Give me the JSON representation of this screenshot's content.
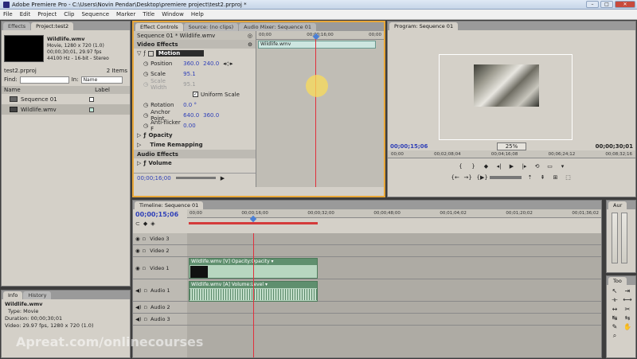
{
  "window": {
    "title": "Adobe Premiere Pro - C:\\Users\\Novin Pendar\\Desktop\\premiere project\\test2.prproj *"
  },
  "menu": [
    "File",
    "Edit",
    "Project",
    "Clip",
    "Sequence",
    "Marker",
    "Title",
    "Window",
    "Help"
  ],
  "project_panel": {
    "tabs": [
      "Effects",
      "Project:test2"
    ],
    "clip_name": "Wildlife.wmv",
    "clip_info_1": "Movie, 1280 x 720 (1.0)",
    "clip_info_2": "00;00;30;01, 29.97 fps",
    "clip_info_3": "44100 Hz - 16-bit - Stereo",
    "project_file": "test2.prproj",
    "items_count": "2 Items",
    "find_label": "Find:",
    "in_label": "In:",
    "in_value": "Name",
    "col_name": "Name",
    "col_label": "Label",
    "items": [
      "Sequence 01",
      "Wildlife.wmv"
    ]
  },
  "info_panel": {
    "tabs": [
      "Info",
      "History"
    ],
    "name": "Wildlife.wmv",
    "type": "Type: Movie",
    "duration": "Duration: 00;00;30;01",
    "video": "Video: 29.97 fps, 1280 x 720 (1.0)"
  },
  "effect_controls": {
    "tabs": [
      "Effect Controls",
      "Source: (no clips)",
      "Audio Mixer: Sequence 01"
    ],
    "header": "Sequence 01 * Wildlife.wmv",
    "timecode_left": "00;00",
    "timecode_mid": "00;00;16;00",
    "timecode_right": "00;00",
    "clip_label": "Wildlife.wmv",
    "section_video": "Video Effects",
    "motion": "Motion",
    "position_label": "Position",
    "position_x": "360.0",
    "position_y": "240.0",
    "scale_label": "Scale",
    "scale_value": "95.1",
    "scale_width_label": "Scale Width",
    "scale_width_value": "95.1",
    "uniform_scale": "Uniform Scale",
    "rotation_label": "Rotation",
    "rotation_value": "0.0 °",
    "anchor_label": "Anchor Point",
    "anchor_x": "640.0",
    "anchor_y": "360.0",
    "antiflicker_label": "Anti-flicker F",
    "antiflicker_value": "0.00",
    "opacity": "Opacity",
    "time_remap": "Time Remapping",
    "section_audio": "Audio Effects",
    "volume": "Volume",
    "footer_time": "00;00;16;00"
  },
  "program_monitor": {
    "tab": "Program: Sequence 01",
    "current_time": "00;00;15;06",
    "zoom": "25%",
    "duration": "00;00;30;01",
    "ruler_labels": [
      "00;00",
      "00;02;08;04",
      "00;04;16;08",
      "00;06;24;12",
      "00;08;32;16"
    ]
  },
  "timeline": {
    "tab": "Timeline: Sequence 01",
    "current_time": "00;00;15;06",
    "ruler_labels": [
      "00;00",
      "00;00;16;00",
      "00;00;32;00",
      "00;00;48;00",
      "00;01;04;02",
      "00;01;20;02",
      "00;01;36;02"
    ],
    "video_tracks": [
      "Video 3",
      "Video 2",
      "Video 1"
    ],
    "audio_tracks": [
      "Audio 1",
      "Audio 2",
      "Audio 3"
    ],
    "video_clip_label": "Wildlife.wmv [V]  Opacity:Opacity ▾",
    "audio_clip_label": "Wildlife.wmv [A]  Volume:Level ▾"
  },
  "side_panels": {
    "audio_tab": "Aur",
    "tools_tab": "Too"
  },
  "watermark": "Apreat.com/onlinecourses",
  "accent_colors": {
    "orange_focus": "#e8a738",
    "playhead_red": "#e0303c",
    "link_blue": "#2e3fb8"
  }
}
